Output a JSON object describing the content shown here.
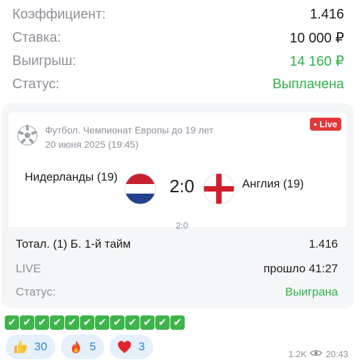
{
  "summary": {
    "coef_label": "Коэффициент:",
    "coef_value": "1.416",
    "stake_label": "Ставка:",
    "stake_value": "10 000 ₽",
    "win_label": "Выигрыш:",
    "win_value": "14 160 ₽",
    "status_label": "Статус:",
    "status_value": "Выплачена"
  },
  "event": {
    "sport_icon": "soccer-ball-icon",
    "competition": "Футбол. Чемпионат Европы до 19 лет",
    "datetime": "20 июня 2025 (19:45)",
    "live_badge": "Live",
    "home_team": "Нидерланды (19)",
    "away_team": "Англия (19)",
    "home_flag_icon": "netherlands-flag-icon",
    "away_flag_icon": "england-flag-icon",
    "score": "2:0",
    "subscore": "2:0"
  },
  "bet": {
    "market": "Тотал. (1) Б. 1-й тайм",
    "odds": "1.416",
    "state_label": "LIVE",
    "state_value": "прошло 41:27",
    "status_label": "Статус:",
    "status_value": "Выиграна"
  },
  "checks": {
    "icon": "check-mark-icon",
    "count": 12
  },
  "reactions": [
    {
      "icon": "thumbs-up-icon",
      "count": "30"
    },
    {
      "icon": "fire-icon",
      "count": "5"
    },
    {
      "icon": "heart-icon",
      "count": "3"
    }
  ],
  "meta": {
    "views": "1.2K",
    "views_icon": "eye-icon",
    "time": "20:43"
  },
  "colors": {
    "green": "#2fb34a",
    "live_red": "#e5363a",
    "reaction_bg": "#e6f0fb",
    "reaction_text": "#2e84d6"
  }
}
